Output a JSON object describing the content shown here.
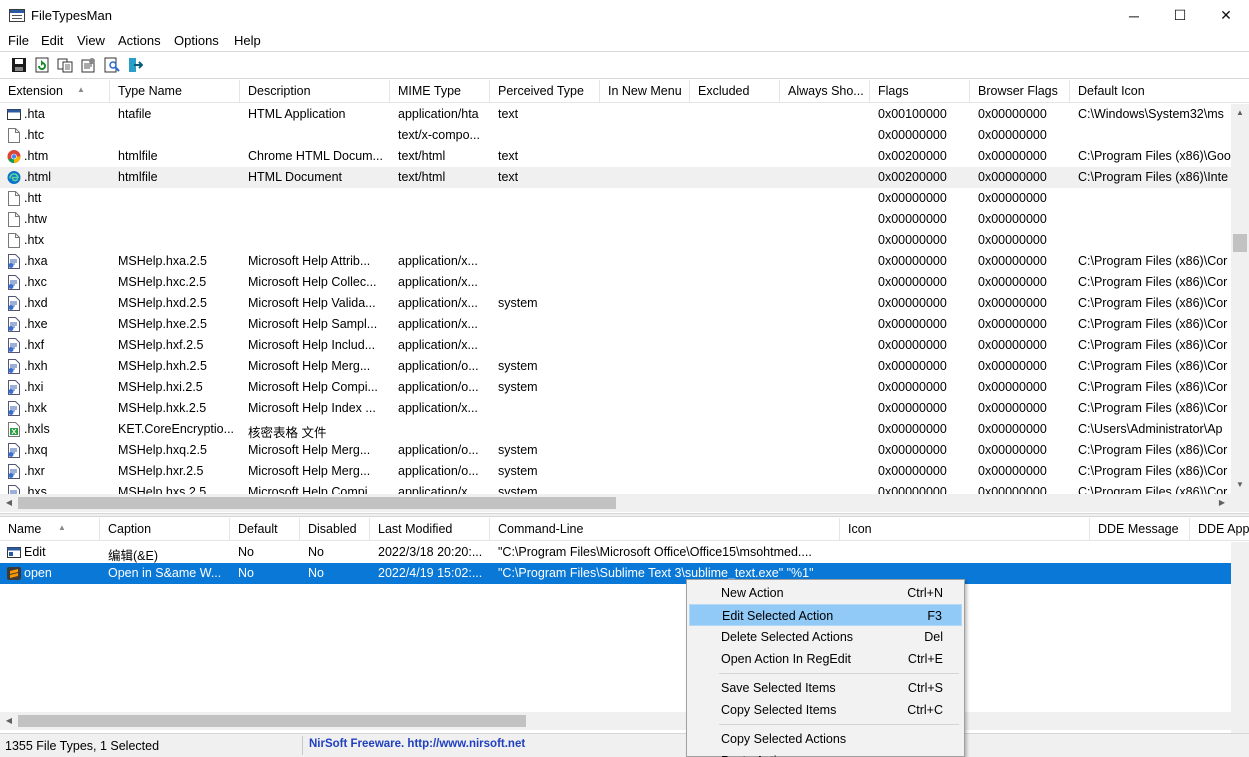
{
  "window": {
    "title": "FileTypesMan",
    "minimize": "─",
    "maximize": "☐",
    "close": "✕"
  },
  "menu": [
    "File",
    "Edit",
    "View",
    "Actions",
    "Options",
    "Help"
  ],
  "toolbar": [
    "save-icon",
    "refresh-icon",
    "copy-icon",
    "properties-icon",
    "find-icon",
    "exit-icon"
  ],
  "top_columns": [
    "Extension",
    "Type Name",
    "Description",
    "MIME Type",
    "Perceived Type",
    "In New Menu",
    "Excluded",
    "Always Sho...",
    "Flags",
    "Browser Flags",
    "Default Icon"
  ],
  "rows": [
    {
      "icon": "hta",
      "ext": ".hta",
      "type": "htafile",
      "desc": "HTML Application",
      "mime": "application/hta",
      "perc": "text",
      "flags": "0x00100000",
      "bflags": "0x00000000",
      "dicon": "C:\\Windows\\System32\\ms"
    },
    {
      "icon": "doc",
      "ext": ".htc",
      "type": "",
      "desc": "",
      "mime": "text/x-compo...",
      "perc": "",
      "flags": "0x00000000",
      "bflags": "0x00000000",
      "dicon": ""
    },
    {
      "icon": "chrome",
      "ext": ".htm",
      "type": "htmlfile",
      "desc": "Chrome HTML Docum...",
      "mime": "text/html",
      "perc": "text",
      "flags": "0x00200000",
      "bflags": "0x00000000",
      "dicon": "C:\\Program Files (x86)\\Goo"
    },
    {
      "icon": "edge",
      "ext": ".html",
      "type": "htmlfile",
      "desc": "HTML Document",
      "mime": "text/html",
      "perc": "text",
      "flags": "0x00200000",
      "bflags": "0x00000000",
      "dicon": "C:\\Program Files (x86)\\Inte"
    },
    {
      "icon": "doc",
      "ext": ".htt",
      "type": "",
      "desc": "",
      "mime": "",
      "perc": "",
      "flags": "0x00000000",
      "bflags": "0x00000000",
      "dicon": ""
    },
    {
      "icon": "doc",
      "ext": ".htw",
      "type": "",
      "desc": "",
      "mime": "",
      "perc": "",
      "flags": "0x00000000",
      "bflags": "0x00000000",
      "dicon": ""
    },
    {
      "icon": "doc",
      "ext": ".htx",
      "type": "",
      "desc": "",
      "mime": "",
      "perc": "",
      "flags": "0x00000000",
      "bflags": "0x00000000",
      "dicon": ""
    },
    {
      "icon": "help",
      "ext": ".hxa",
      "type": "MSHelp.hxa.2.5",
      "desc": "Microsoft Help Attrib...",
      "mime": "application/x...",
      "perc": "",
      "flags": "0x00000000",
      "bflags": "0x00000000",
      "dicon": "C:\\Program Files (x86)\\Cor"
    },
    {
      "icon": "help",
      "ext": ".hxc",
      "type": "MSHelp.hxc.2.5",
      "desc": "Microsoft Help Collec...",
      "mime": "application/x...",
      "perc": "",
      "flags": "0x00000000",
      "bflags": "0x00000000",
      "dicon": "C:\\Program Files (x86)\\Cor"
    },
    {
      "icon": "help",
      "ext": ".hxd",
      "type": "MSHelp.hxd.2.5",
      "desc": "Microsoft Help Valida...",
      "mime": "application/x...",
      "perc": "system",
      "flags": "0x00000000",
      "bflags": "0x00000000",
      "dicon": "C:\\Program Files (x86)\\Cor"
    },
    {
      "icon": "help",
      "ext": ".hxe",
      "type": "MSHelp.hxe.2.5",
      "desc": "Microsoft Help Sampl...",
      "mime": "application/x...",
      "perc": "",
      "flags": "0x00000000",
      "bflags": "0x00000000",
      "dicon": "C:\\Program Files (x86)\\Cor"
    },
    {
      "icon": "help",
      "ext": ".hxf",
      "type": "MSHelp.hxf.2.5",
      "desc": "Microsoft Help Includ...",
      "mime": "application/x...",
      "perc": "",
      "flags": "0x00000000",
      "bflags": "0x00000000",
      "dicon": "C:\\Program Files (x86)\\Cor"
    },
    {
      "icon": "help",
      "ext": ".hxh",
      "type": "MSHelp.hxh.2.5",
      "desc": "Microsoft Help Merg...",
      "mime": "application/o...",
      "perc": "system",
      "flags": "0x00000000",
      "bflags": "0x00000000",
      "dicon": "C:\\Program Files (x86)\\Cor"
    },
    {
      "icon": "help",
      "ext": ".hxi",
      "type": "MSHelp.hxi.2.5",
      "desc": "Microsoft Help Compi...",
      "mime": "application/o...",
      "perc": "system",
      "flags": "0x00000000",
      "bflags": "0x00000000",
      "dicon": "C:\\Program Files (x86)\\Cor"
    },
    {
      "icon": "help",
      "ext": ".hxk",
      "type": "MSHelp.hxk.2.5",
      "desc": "Microsoft Help Index ...",
      "mime": "application/x...",
      "perc": "",
      "flags": "0x00000000",
      "bflags": "0x00000000",
      "dicon": "C:\\Program Files (x86)\\Cor"
    },
    {
      "icon": "kso",
      "ext": ".hxls",
      "type": "KET.CoreEncryptio...",
      "desc": "核密表格 文件",
      "mime": "",
      "perc": "",
      "flags": "0x00000000",
      "bflags": "0x00000000",
      "dicon": "C:\\Users\\Administrator\\Ap"
    },
    {
      "icon": "help",
      "ext": ".hxq",
      "type": "MSHelp.hxq.2.5",
      "desc": "Microsoft Help Merg...",
      "mime": "application/o...",
      "perc": "system",
      "flags": "0x00000000",
      "bflags": "0x00000000",
      "dicon": "C:\\Program Files (x86)\\Cor"
    },
    {
      "icon": "help",
      "ext": ".hxr",
      "type": "MSHelp.hxr.2.5",
      "desc": "Microsoft Help Merg...",
      "mime": "application/o...",
      "perc": "system",
      "flags": "0x00000000",
      "bflags": "0x00000000",
      "dicon": "C:\\Program Files (x86)\\Cor"
    },
    {
      "icon": "help",
      "ext": ".hxs",
      "type": "MSHelp.hxs.2.5",
      "desc": "Microsoft Help Compi...",
      "mime": "application/x...",
      "perc": "system",
      "flags": "0x00000000",
      "bflags": "0x00000000",
      "dicon": "C:\\Program Files (x86)\\Cor"
    }
  ],
  "bottom_columns": [
    "Name",
    "Caption",
    "Default",
    "Disabled",
    "Last Modified",
    "Command-Line",
    "Icon",
    "DDE Message",
    "DDE App"
  ],
  "actions": [
    {
      "icon": "window",
      "name": "Edit",
      "caption": "编辑(&E)",
      "default": "No",
      "disabled": "No",
      "modified": "2022/3/18 20:20:...",
      "cmd": "\"C:\\Program Files\\Microsoft Office\\Office15\\msohtmed....",
      "selected": false
    },
    {
      "icon": "sublime",
      "name": "open",
      "caption": "Open in S&ame W...",
      "default": "No",
      "disabled": "No",
      "modified": "2022/4/19 15:02:...",
      "cmd": "\"C:\\Program Files\\Sublime Text 3\\sublime_text.exe\" \"%1\"",
      "selected": true
    }
  ],
  "context_menu": [
    {
      "label": "New Action",
      "key": "Ctrl+N"
    },
    {
      "label": "Edit Selected Action",
      "key": "F3",
      "highlight": true
    },
    {
      "label": "Delete Selected Actions",
      "key": "Del"
    },
    {
      "label": "Open Action In RegEdit",
      "key": "Ctrl+E"
    },
    {
      "sep": true
    },
    {
      "label": "Save Selected Items",
      "key": "Ctrl+S"
    },
    {
      "label": "Copy Selected Items",
      "key": "Ctrl+C"
    },
    {
      "sep": true
    },
    {
      "label": "Copy Selected Actions",
      "key": ""
    },
    {
      "label": "Paste Actions",
      "key": ""
    }
  ],
  "status": {
    "count": "1355 File Types, 1 Selected",
    "link": "NirSoft Freeware.  http://www.nirsoft.net"
  }
}
